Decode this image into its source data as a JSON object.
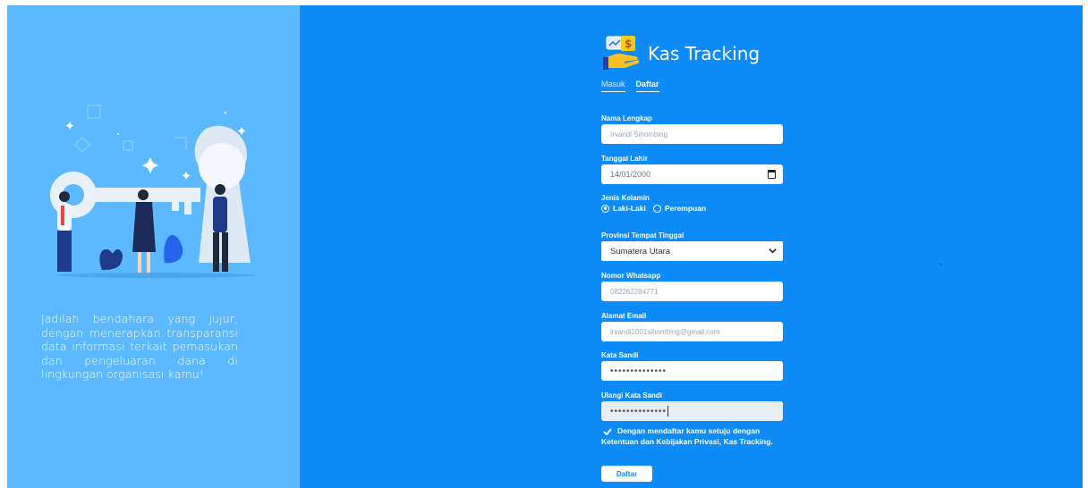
{
  "app": {
    "title": "Kas Tracking"
  },
  "left": {
    "tagline": "Jadilah bendahara yang jujur, dengan menerapkan transparansi data informasi terkait pemasukan dan pengeluaran dana di lingkungan organisasi kamu!"
  },
  "tabs": [
    {
      "label": "Masuk",
      "active": false
    },
    {
      "label": "Daftar",
      "active": true
    }
  ],
  "form": {
    "full_name": {
      "label": "Nama Lengkap",
      "value": "Irvandi Sihombing"
    },
    "birth_date": {
      "label": "Tanggal Lahir",
      "value": "14/01/2000"
    },
    "gender": {
      "label": "Jenis Kelamin",
      "options": [
        "Laki-Laki",
        "Perempuan"
      ],
      "selected": "Laki-Laki"
    },
    "province": {
      "label": "Provinsi Tempat Tinggal",
      "value": "Sumatera Utara"
    },
    "whatsapp": {
      "label": "Nomor Whatsapp",
      "value": "082262284771"
    },
    "email": {
      "label": "Alamat Email",
      "value": "irvandi1001sihombing@gmail.com"
    },
    "password": {
      "label": "Kata Sandi",
      "value": "••••••••••••••"
    },
    "password_confirm": {
      "label": "Ulangi Kata Sandi",
      "value": "••••••••••••••"
    },
    "agreement": "Dengan mendaftar kamu setuju dengan Ketentuan dan Kebijakan Privasi, Kas Tracking.",
    "submit_label": "Daftar"
  },
  "colors": {
    "left_panel": "#5cb8ff",
    "right_panel": "#0d8cf9",
    "text_light": "#ffffff"
  },
  "icons": {
    "logo": "money-hand-icon",
    "calendar": "calendar-icon",
    "dropdown": "chevron-down-icon",
    "check": "check-icon"
  }
}
